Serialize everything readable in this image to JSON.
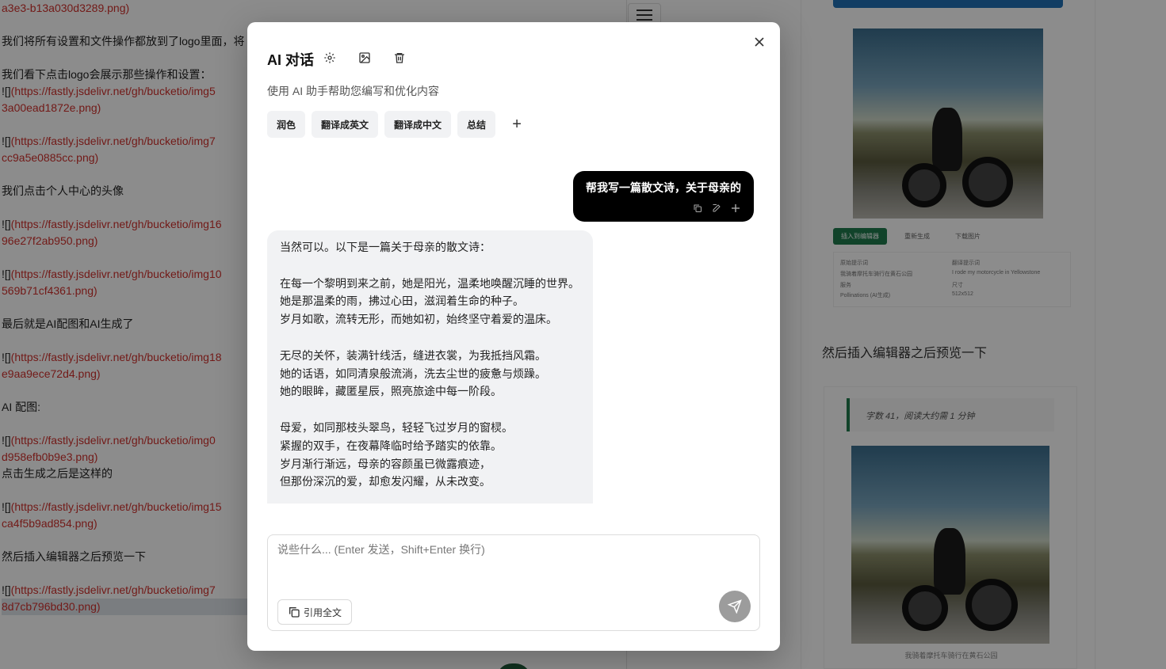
{
  "editor": {
    "lines": [
      {
        "text": "a3e3-b13a030d3289.png)",
        "type": "link"
      },
      {
        "text": "",
        "type": "gap"
      },
      {
        "text": "我们将所有设置和文件操作都放到了logo里面，将",
        "type": "text"
      },
      {
        "text": "",
        "type": "gap"
      },
      {
        "text": "我们看下点击logo会展示那些操作和设置：",
        "type": "text"
      },
      {
        "prefix": "![]",
        "text": "(https://fastly.jsdelivr.net/gh/bucketio/img5",
        "type": "mdlink"
      },
      {
        "text": "3a00ead1872e.png)",
        "type": "link"
      },
      {
        "text": "",
        "type": "gap"
      },
      {
        "prefix": "![]",
        "text": "(https://fastly.jsdelivr.net/gh/bucketio/img7",
        "type": "mdlink"
      },
      {
        "text": "cc9a5e0885cc.png)",
        "type": "link"
      },
      {
        "text": "",
        "type": "gap"
      },
      {
        "text": "我们点击个人中心的头像",
        "type": "text"
      },
      {
        "text": "",
        "type": "gap"
      },
      {
        "prefix": "![]",
        "text": "(https://fastly.jsdelivr.net/gh/bucketio/img16",
        "type": "mdlink"
      },
      {
        "text": "96e27f2ab950.png)",
        "type": "link"
      },
      {
        "text": "",
        "type": "gap"
      },
      {
        "prefix": "![]",
        "text": "(https://fastly.jsdelivr.net/gh/bucketio/img10",
        "type": "mdlink"
      },
      {
        "text": "569b71cf4361.png)",
        "type": "link"
      },
      {
        "text": "",
        "type": "gap"
      },
      {
        "text": "最后就是AI配图和AI生成了",
        "type": "text"
      },
      {
        "text": "",
        "type": "gap"
      },
      {
        "prefix": "![]",
        "text": "(https://fastly.jsdelivr.net/gh/bucketio/img18",
        "type": "mdlink"
      },
      {
        "text": "e9aa9ece72d4.png)",
        "type": "link"
      },
      {
        "text": "",
        "type": "gap"
      },
      {
        "text": "AI 配图:",
        "type": "text"
      },
      {
        "text": "",
        "type": "gap"
      },
      {
        "prefix": "![]",
        "text": "(https://fastly.jsdelivr.net/gh/bucketio/img0",
        "type": "mdlink"
      },
      {
        "text": "d958efb0b9e3.png)",
        "type": "link"
      },
      {
        "text": "点击生成之后是这样的",
        "type": "text"
      },
      {
        "text": "",
        "type": "gap"
      },
      {
        "prefix": "![]",
        "text": "(https://fastly.jsdelivr.net/gh/bucketio/img15",
        "type": "mdlink"
      },
      {
        "text": "ca4f5b9ad854.png)",
        "type": "link"
      },
      {
        "text": "",
        "type": "gap"
      },
      {
        "text": "然后插入编辑器之后预览一下",
        "type": "text"
      },
      {
        "text": "",
        "type": "gap"
      },
      {
        "prefix": "![]",
        "text": "(https://fastly.jsdelivr.net/gh/bucketio/img7",
        "type": "mdlink"
      },
      {
        "text": "8d7cb796bd30.png)",
        "type": "link"
      }
    ]
  },
  "preview": {
    "insert_label": "插入到编辑器",
    "regen_label": "重新生成",
    "download_label": "下载图片",
    "meta": [
      "原始提示词",
      "翻译提示词",
      "我骑着摩托车骑行在黄石公园",
      "I rode my motorcycle in Yellowstone",
      "服务",
      "尺寸",
      "Pollinations (AI生成)",
      "512x512"
    ],
    "heading": "然后插入编辑器之后预览一下",
    "quote": "字数 41，阅读大约需 1 分钟",
    "caption": "我骑着摩托车骑行在黄石公园"
  },
  "dialog": {
    "title": "AI 对话",
    "subtitle": "使用 AI 助手帮助您编写和优化内容",
    "quick_actions": [
      "润色",
      "翻译成英文",
      "翻译成中文",
      "总结"
    ],
    "add_label": "+",
    "close_label": "×",
    "user_message": "帮我写一篇散文诗，关于母亲的",
    "ai_message_lines": [
      "当然可以。以下是一篇关于母亲的散文诗：",
      "",
      "在每一个黎明到来之前，她是阳光，温柔地唤醒沉睡的世界。",
      "她是那温柔的雨，拂过心田，滋润着生命的种子。",
      "岁月如歌，流转无形，而她如初，始终坚守着爱的温床。",
      "",
      "无尽的关怀，装满针线活，缝进衣裳，为我抵挡风霜。",
      "她的话语，如同清泉般流淌，洗去尘世的疲惫与烦躁。",
      "她的眼眸，藏匿星辰，照亮旅途中每一阶段。",
      "",
      "母爱，如同那枝头翠鸟，轻轻飞过岁月的窗棂。",
      "紧握的双手，在夜幕降临时给予踏实的依靠。",
      "岁月渐行渐远，母亲的容颜虽已微露痕迹，",
      "但那份深沉的爱，却愈发闪耀，从未改变。"
    ],
    "input_placeholder": "说些什么... (Enter 发送，Shift+Enter 换行)",
    "quote_all_label": "引用全文"
  }
}
